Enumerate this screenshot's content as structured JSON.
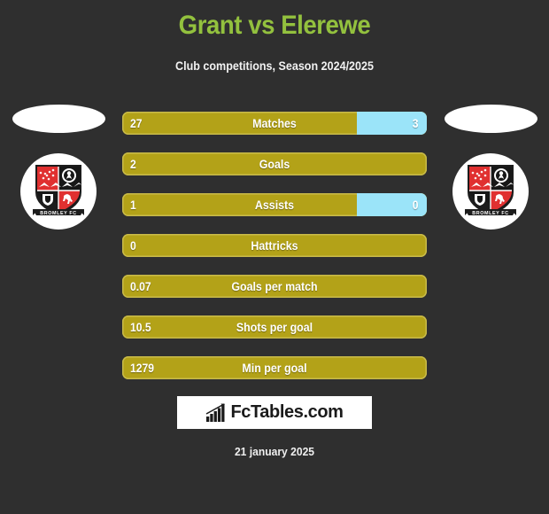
{
  "header": {
    "title": "Grant vs Elerewe",
    "subtitle": "Club competitions, Season 2024/2025",
    "title_color": "#93c13e"
  },
  "colors": {
    "background": "#2f2f2f",
    "bar_home": "#b3a218",
    "bar_away": "#9be4f9",
    "text": "#ffffff"
  },
  "players": {
    "home": {
      "club_badge": "bromley-fc-badge",
      "badge_text": "BROMLEY FC"
    },
    "away": {
      "club_badge": "bromley-fc-badge",
      "badge_text": "BROMLEY FC"
    }
  },
  "stats": [
    {
      "label": "Matches",
      "home": "27",
      "away": "3",
      "home_pct": 77
    },
    {
      "label": "Goals",
      "home": "2",
      "away": "",
      "home_pct": 100
    },
    {
      "label": "Assists",
      "home": "1",
      "away": "0",
      "home_pct": 77
    },
    {
      "label": "Hattricks",
      "home": "0",
      "away": "",
      "home_pct": 100
    },
    {
      "label": "Goals per match",
      "home": "0.07",
      "away": "",
      "home_pct": 100
    },
    {
      "label": "Shots per goal",
      "home": "10.5",
      "away": "",
      "home_pct": 100
    },
    {
      "label": "Min per goal",
      "home": "1279",
      "away": "",
      "home_pct": 100
    }
  ],
  "footer": {
    "logo_text": "FcTables.com",
    "logo_icon": "bar-chart-growth-icon",
    "date": "21 january 2025"
  }
}
